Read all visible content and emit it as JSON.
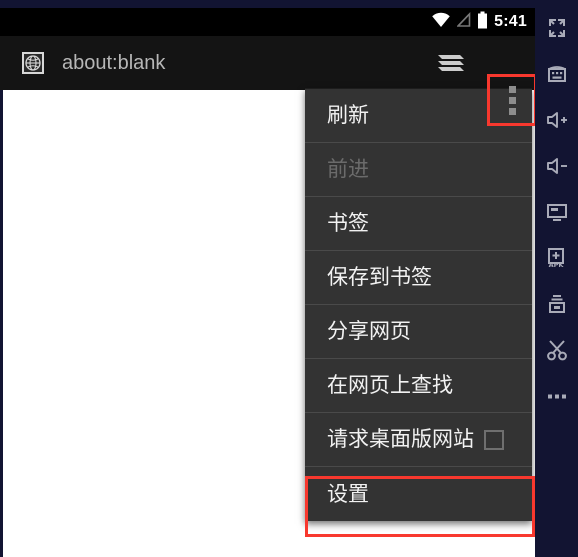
{
  "statusbar": {
    "clock": "5:41",
    "icons": [
      "wifi-icon",
      "signal-off-icon",
      "battery-icon"
    ]
  },
  "toolbar": {
    "favicon": "globe-icon",
    "url": "about:blank",
    "tabs_icon": "tabs-stack-icon",
    "overflow_icon": "overflow-menu-icon"
  },
  "menu": {
    "items": [
      {
        "label": "刷新",
        "enabled": true,
        "checkbox": false,
        "highlighted": false
      },
      {
        "label": "前进",
        "enabled": false,
        "checkbox": false,
        "highlighted": false
      },
      {
        "label": "书签",
        "enabled": true,
        "checkbox": false,
        "highlighted": false
      },
      {
        "label": "保存到书签",
        "enabled": true,
        "checkbox": false,
        "highlighted": false
      },
      {
        "label": "分享网页",
        "enabled": true,
        "checkbox": false,
        "highlighted": false
      },
      {
        "label": "在网页上查找",
        "enabled": true,
        "checkbox": false,
        "highlighted": false
      },
      {
        "label": "请求桌面版网站",
        "enabled": true,
        "checkbox": true,
        "checked": false,
        "highlighted": false
      },
      {
        "label": "设置",
        "enabled": true,
        "checkbox": false,
        "highlighted": true
      }
    ]
  },
  "sidebar": {
    "items": [
      {
        "icon": "fullscreen-icon"
      },
      {
        "icon": "keyboard-icon"
      },
      {
        "icon": "volume-up-icon"
      },
      {
        "icon": "volume-down-icon"
      },
      {
        "icon": "display-icon"
      },
      {
        "icon": "install-apk-icon"
      },
      {
        "icon": "file-transfer-icon"
      },
      {
        "icon": "scissors-icon"
      },
      {
        "icon": "more-options-icon"
      }
    ]
  },
  "colors": {
    "highlight": "#f8382e",
    "sidebar_bg": "#121432",
    "menu_bg": "#333333",
    "toolbar_bg": "#141414",
    "statusbar_bg": "#000000"
  }
}
